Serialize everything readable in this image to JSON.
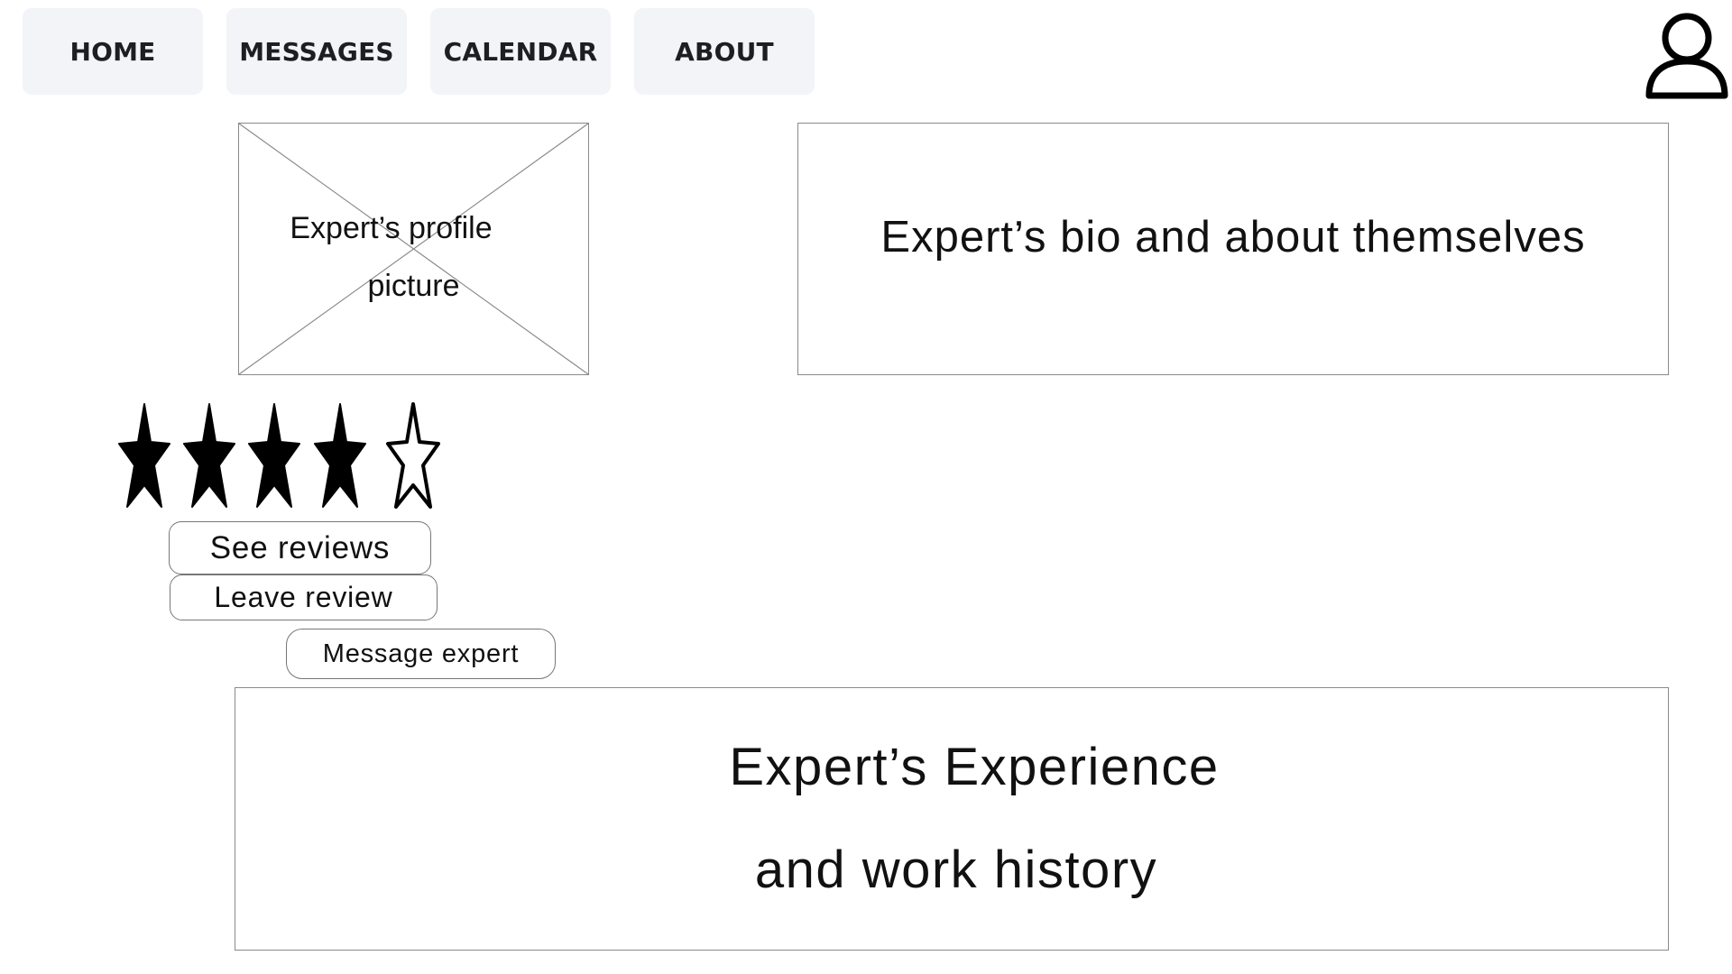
{
  "nav": {
    "items": [
      {
        "label": "HOME"
      },
      {
        "label": "MESSAGES"
      },
      {
        "label": "CALENDAR"
      },
      {
        "label": "ABOUT"
      }
    ],
    "user_icon": "user-profile-icon"
  },
  "profile": {
    "picture_label_line1": "Expert’s profile",
    "picture_label_line2": "picture",
    "bio_text": "Expert’s bio and about themselves",
    "rating": {
      "value": 4,
      "max": 5,
      "filled_star_icon": "star-filled-icon",
      "empty_star_icon": "star-outline-icon"
    },
    "actions": {
      "see_reviews": "See reviews",
      "leave_review": "Leave review",
      "message_expert": "Message expert"
    },
    "experience_line1": "Expert’s Experience",
    "experience_line2": "and work history"
  },
  "colors": {
    "nav_background": "#f2f4f7",
    "nav_text": "#1c1e24",
    "border": "#8a8a8a",
    "text": "#111111"
  }
}
